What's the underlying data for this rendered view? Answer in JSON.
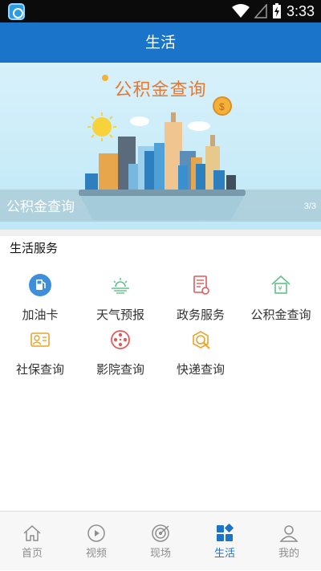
{
  "status_bar": {
    "time": "3:33",
    "colors": {
      "background": "#0b0b0b"
    }
  },
  "header": {
    "title": "生活",
    "color": "#1a74c9"
  },
  "banner": {
    "title": "公积金查询",
    "caption": "公积金查询",
    "page_indicator": "3/3"
  },
  "services": {
    "section_title": "生活服务",
    "items": [
      {
        "label": "加油卡",
        "icon": "fuel-icon"
      },
      {
        "label": "天气预报",
        "icon": "weather-icon"
      },
      {
        "label": "政务服务",
        "icon": "document-icon"
      },
      {
        "label": "公积金查询",
        "icon": "house-fund-icon"
      },
      {
        "label": "社保查询",
        "icon": "id-card-icon"
      },
      {
        "label": "影院查询",
        "icon": "film-reel-icon"
      },
      {
        "label": "快递查询",
        "icon": "package-search-icon"
      }
    ]
  },
  "bottom_nav": {
    "active": "生活",
    "tabs": [
      {
        "label": "首页",
        "icon": "home-icon"
      },
      {
        "label": "视频",
        "icon": "play-icon"
      },
      {
        "label": "现场",
        "icon": "target-icon"
      },
      {
        "label": "生活",
        "icon": "grid-icon"
      },
      {
        "label": "我的",
        "icon": "user-icon"
      }
    ],
    "colors": {
      "active": "#1a74c9",
      "inactive": "#8e8e8e"
    }
  }
}
